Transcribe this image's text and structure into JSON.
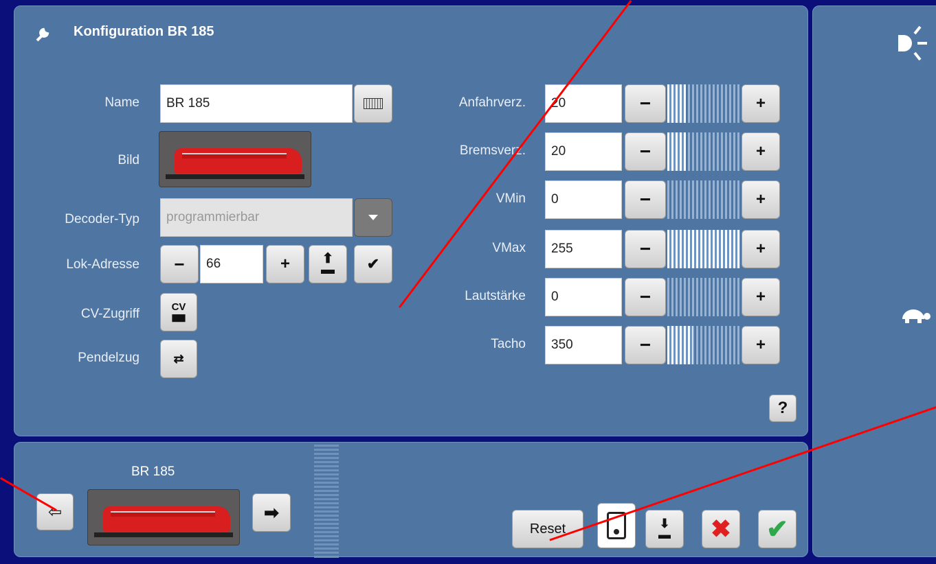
{
  "config": {
    "title": "Konfiguration BR 185",
    "name_label": "Name",
    "name_value": "BR 185",
    "bild_label": "Bild",
    "decoder_label": "Decoder-Typ",
    "decoder_value": "programmierbar",
    "address_label": "Lok-Adresse",
    "address_value": "66",
    "cv_label": "CV-Zugriff",
    "cv_icon_text": "CV",
    "pendel_label": "Pendelzug",
    "params": [
      {
        "label": "Anfahrverz.",
        "value": "20",
        "level": 0.25
      },
      {
        "label": "Bremsverz.",
        "value": "20",
        "level": 0.25
      },
      {
        "label": "VMin",
        "value": "0",
        "level": 0
      },
      {
        "label": "VMax",
        "value": "255",
        "level": 1.0
      },
      {
        "label": "Lautstärke",
        "value": "0",
        "level": 0
      },
      {
        "label": "Tacho",
        "value": "350",
        "level": 0.35
      }
    ],
    "help": "?"
  },
  "bottom": {
    "loco_name": "BR 185",
    "reset_label": "Reset"
  },
  "colors": {
    "panel": "#4f76a3",
    "accent_red": "#ff0000",
    "ok_green": "#2ea84a"
  }
}
